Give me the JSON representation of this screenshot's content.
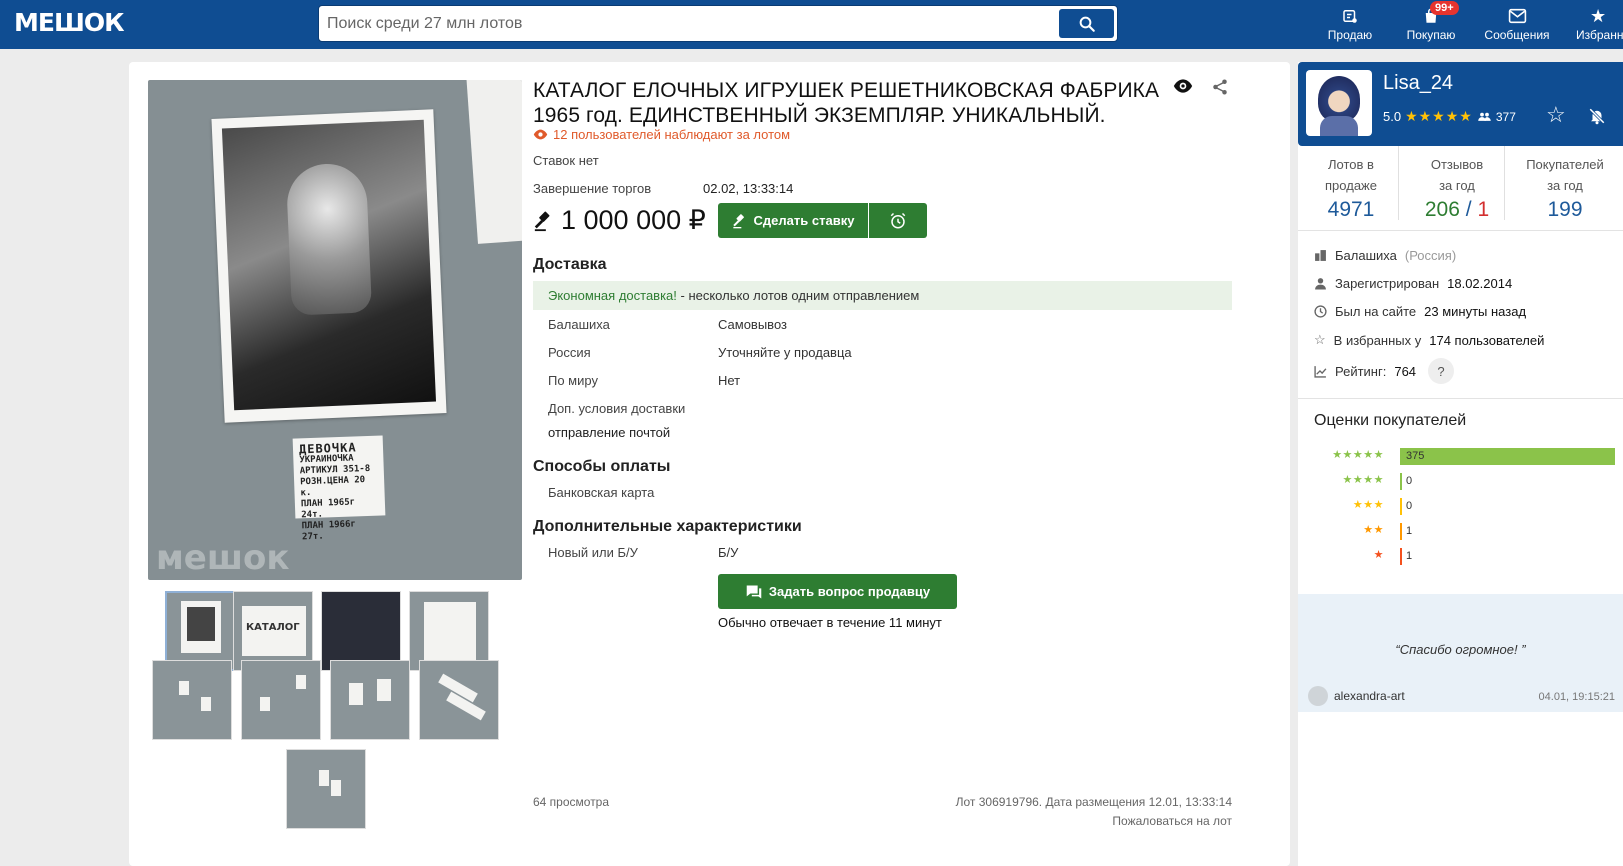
{
  "header": {
    "logo": "МЕШОК",
    "search_placeholder": "Поиск среди 27 млн лотов",
    "nav": [
      {
        "label": "Продаю",
        "icon": "sell-icon"
      },
      {
        "label": "Покупаю",
        "icon": "bag-icon",
        "badge": "99+"
      },
      {
        "label": "Сообщения",
        "icon": "mail-icon"
      },
      {
        "label": "Избранн",
        "icon": "star-icon"
      }
    ]
  },
  "photo": {
    "label_lines": [
      "ДЕВОЧКА",
      "УКРАИНОЧКА",
      "АРТИКУЛ 351-8",
      "РОЗН.ЦЕНА 20 к.",
      "ПЛАН 1965г 24т.",
      "ПЛАН 1966г 27т."
    ],
    "watermark": "мешок"
  },
  "thumbs": [
    {
      "caption": "КАТАЛОГ"
    }
  ],
  "lot": {
    "title": "КАТАЛОГ ЕЛОЧНЫХ ИГРУШЕК РЕШЕТНИКОВСКАЯ ФАБРИКА 1965 год. ЕДИНСТВЕННЫЙ ЭКЗЕМПЛЯР. УНИКАЛЬНЫЙ.",
    "watchers": "12 пользователей наблюдают за лотом",
    "bids": "Ставок нет",
    "end_label": "Завершение торгов",
    "end_value": "02.02, 13:33:14",
    "price": "1 000 000 ₽",
    "bid_button": "Сделать ставку",
    "delivery_title": "Доставка",
    "eco_highlight": "Экономная доставка!",
    "eco_text": " - несколько лотов одним отправлением",
    "delivery": [
      {
        "place": "Балашиха",
        "value": "Самовывоз"
      },
      {
        "place": "Россия",
        "value": "Уточняйте у продавца"
      },
      {
        "place": "По миру",
        "value": "Нет"
      }
    ],
    "extra_delivery_label": "Доп. условия доставки",
    "extra_delivery_value": "отправление почтой",
    "payment_title": "Способы оплаты",
    "payment_value": "Банковская карта",
    "chars_title": "Дополнительные характеристики",
    "char_label": "Новый или Б/У",
    "char_value": "Б/У",
    "ask_button": "Задать вопрос продавцу",
    "reply_time": "Обычно отвечает в течение 11 минут",
    "views": "64 просмотра",
    "lot_info": "Лот 306919796. Дата размещения 12.01, 13:33:14",
    "complain": "Пожаловаться на лот"
  },
  "seller": {
    "name": "Lisa_24",
    "rating": "5.0",
    "stars": "★★★★★",
    "reviews_count": "377",
    "stats": [
      {
        "label": "Лотов в продаже",
        "value": "4971"
      },
      {
        "label": "Отзывов за год",
        "good": "206",
        "sep": " / ",
        "bad": "1"
      },
      {
        "label": "Покупателей за год",
        "value": "199"
      }
    ],
    "city": "Балашиха",
    "country": "(Россия)",
    "registered_label": "Зарегистрирован",
    "registered_value": "18.02.2014",
    "last_seen_label": "Был на сайте",
    "last_seen_value": "23 минуты назад",
    "fav_label": "В избранных у",
    "fav_value": "174 пользователей",
    "rating_label": "Рейтинг:",
    "rating_value": "764",
    "help": "?"
  },
  "ratings": {
    "title": "Оценки покупателей",
    "rows": [
      {
        "stars": "★★★★★",
        "count": "375",
        "color": "#8bc34a",
        "fraction": 0.995
      },
      {
        "stars": "★★★★",
        "count": "0",
        "color": "#8bc34a",
        "fraction": 0
      },
      {
        "stars": "★★★",
        "count": "0",
        "color": "#ffc107",
        "fraction": 0
      },
      {
        "stars": "★★",
        "count": "1",
        "color": "#ff9800",
        "fraction": 0.003
      },
      {
        "stars": "★",
        "count": "1",
        "color": "#f4511e",
        "fraction": 0.003
      }
    ]
  },
  "review": {
    "text": "“Спасибо огромное! ”",
    "author": "alexandra-art",
    "date": "04.01, 19:15:21"
  },
  "colors": {
    "brand": "#0f4d92",
    "accent_green": "#2e7d32",
    "badge_red": "#e5342e"
  }
}
